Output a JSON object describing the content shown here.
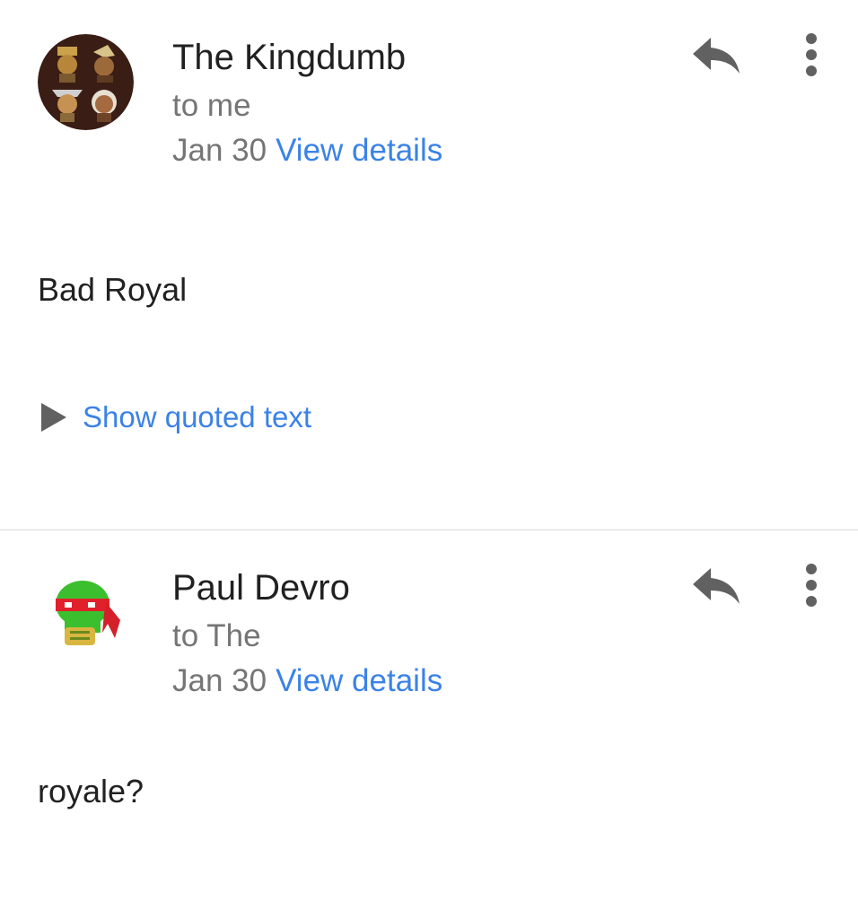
{
  "messages": [
    {
      "sender": "The Kingdumb",
      "recipient": "to me",
      "date": "Jan 30",
      "details_link": "View details",
      "body": "Bad Royal",
      "show_quoted": "Show quoted text"
    },
    {
      "sender": "Paul Devro",
      "recipient": "to The",
      "date": "Jan 30",
      "details_link": "View details",
      "body": "royale?"
    }
  ],
  "icons": {
    "reply": "reply-icon",
    "more": "more-vert-icon",
    "quoted": "triangle-right-icon"
  },
  "colors": {
    "link": "#3b82e6",
    "secondary_text": "#757575",
    "primary_text": "#212121",
    "icon": "#616161"
  }
}
